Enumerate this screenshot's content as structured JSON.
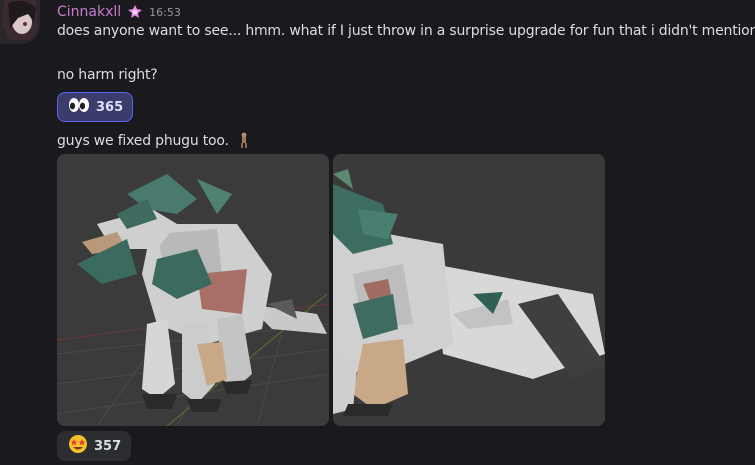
{
  "message": {
    "author": "Cinnakxll",
    "timestamp": "16:53",
    "line1": "does anyone want to see... hmm. what if I just throw in a surprise upgrade for fun that i didn't mention.",
    "line2": "no harm right?",
    "reaction1": {
      "emoji": "eyes-emoji",
      "count": "365",
      "state": "active"
    },
    "line3": "guys we fixed phugu too.",
    "attachments": [
      {
        "name": "render-front-view"
      },
      {
        "name": "render-side-view"
      }
    ],
    "reaction2": {
      "emoji": "star-struck-emoji",
      "count": "357",
      "state": "inactive"
    }
  },
  "colors": {
    "background": "#1a1a1e",
    "username": "#c77dcf",
    "reaction_active_bg": "#3a3c6b",
    "reaction_active_border": "#5865f2",
    "reaction_inactive_bg": "#2b2d31"
  }
}
